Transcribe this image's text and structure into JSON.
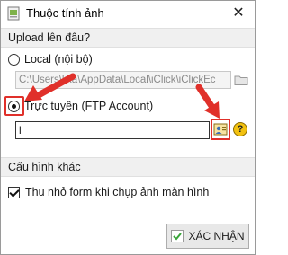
{
  "window": {
    "title": "Thuộc tính ảnh",
    "close_glyph": "✕"
  },
  "upload_section": {
    "header": "Upload lên đâu?",
    "local_label": "Local (nội bộ)",
    "local_path": "C:\\Users\\lika\\AppData\\Local\\iClick\\iClickEc",
    "online_label": "Trực tuyến (FTP Account)",
    "ftp_value": "l",
    "selected": "online"
  },
  "other_section": {
    "header": "Cấu hình khác",
    "minimize_label": "Thu nhỏ form khi chụp ảnh màn hình",
    "minimize_checked": true
  },
  "confirm_button": {
    "label": "XÁC NHẬN",
    "icon": "check-icon"
  },
  "help_glyph": "?",
  "colors": {
    "annotation_red": "#e0302a",
    "help_yellow": "#f2c10f",
    "confirm_check_green": "#3aa53a"
  }
}
